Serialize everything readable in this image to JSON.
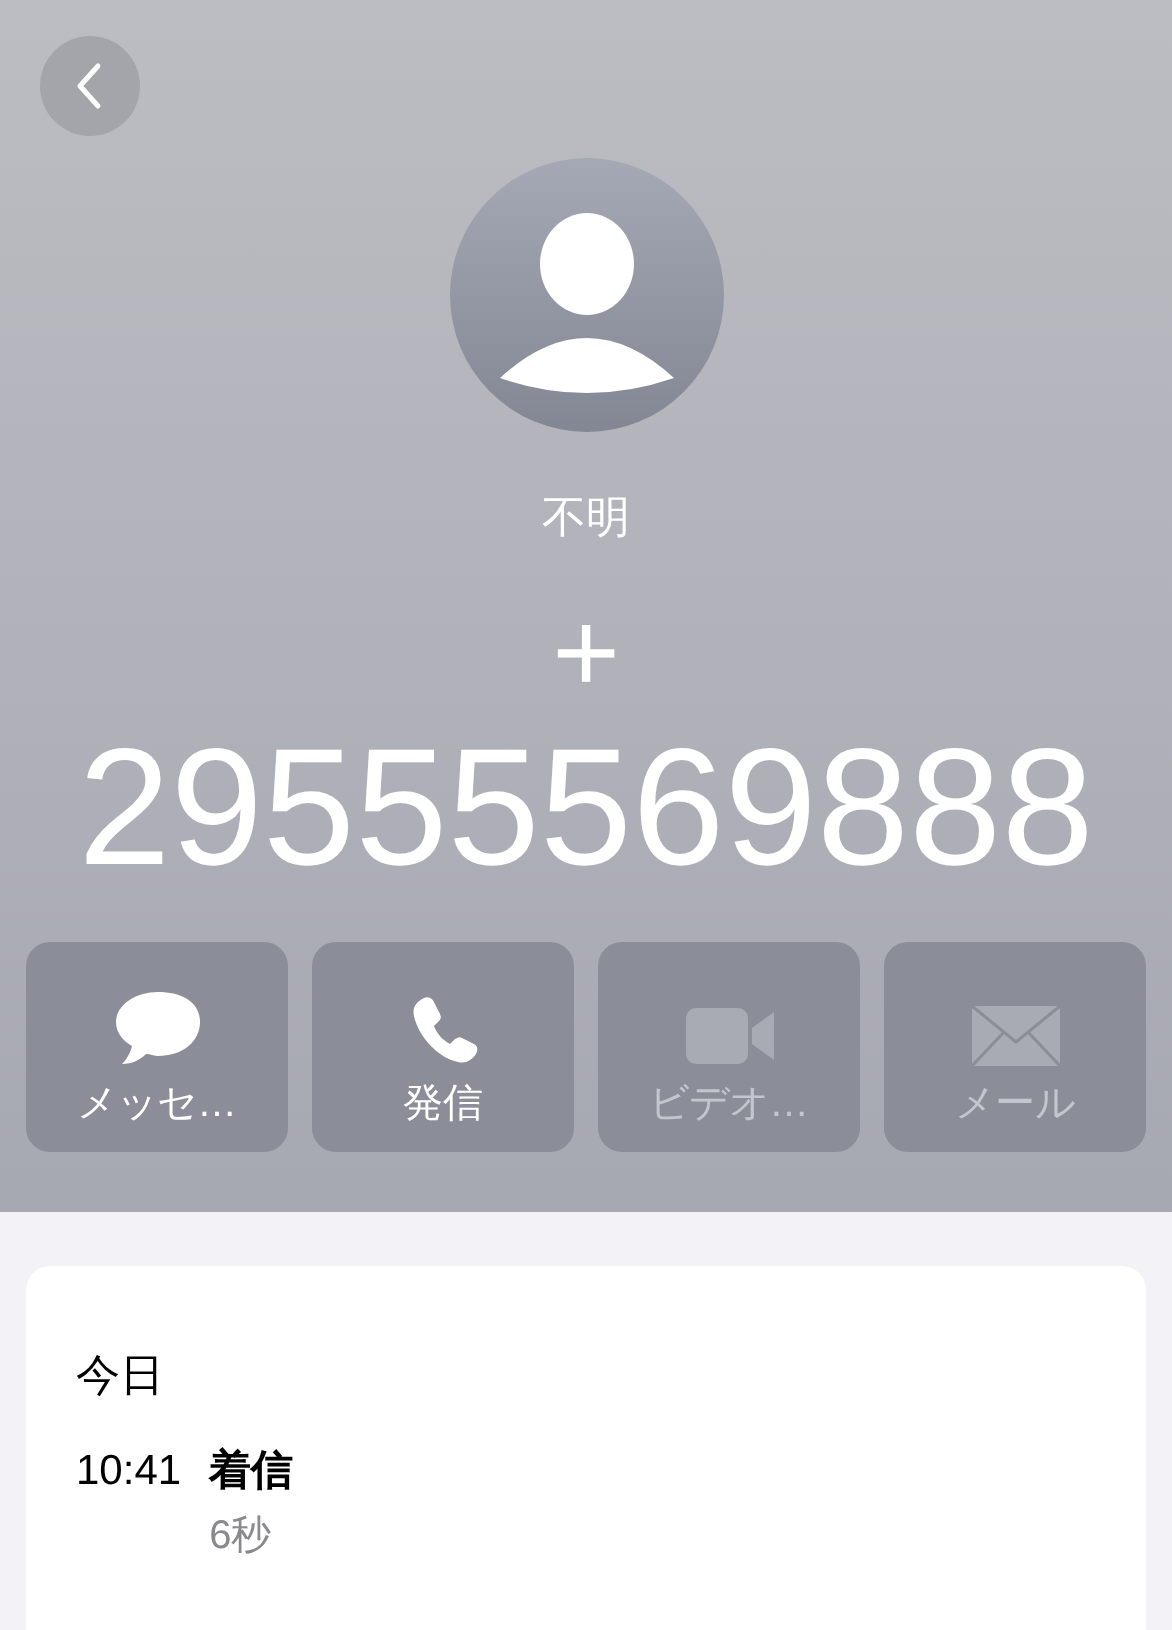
{
  "contact": {
    "name": "不明",
    "prefix": "+",
    "number": "29555569888"
  },
  "actions": [
    {
      "kind": "message",
      "label": "メッセ…",
      "disabled": false
    },
    {
      "kind": "call",
      "label": "発信",
      "disabled": false
    },
    {
      "kind": "video",
      "label": "ビデオ…",
      "disabled": true
    },
    {
      "kind": "mail",
      "label": "メール",
      "disabled": true
    }
  ],
  "history": {
    "date": "今日",
    "entries": [
      {
        "time": "10:41",
        "type": "着信",
        "duration": "6秒"
      }
    ]
  }
}
